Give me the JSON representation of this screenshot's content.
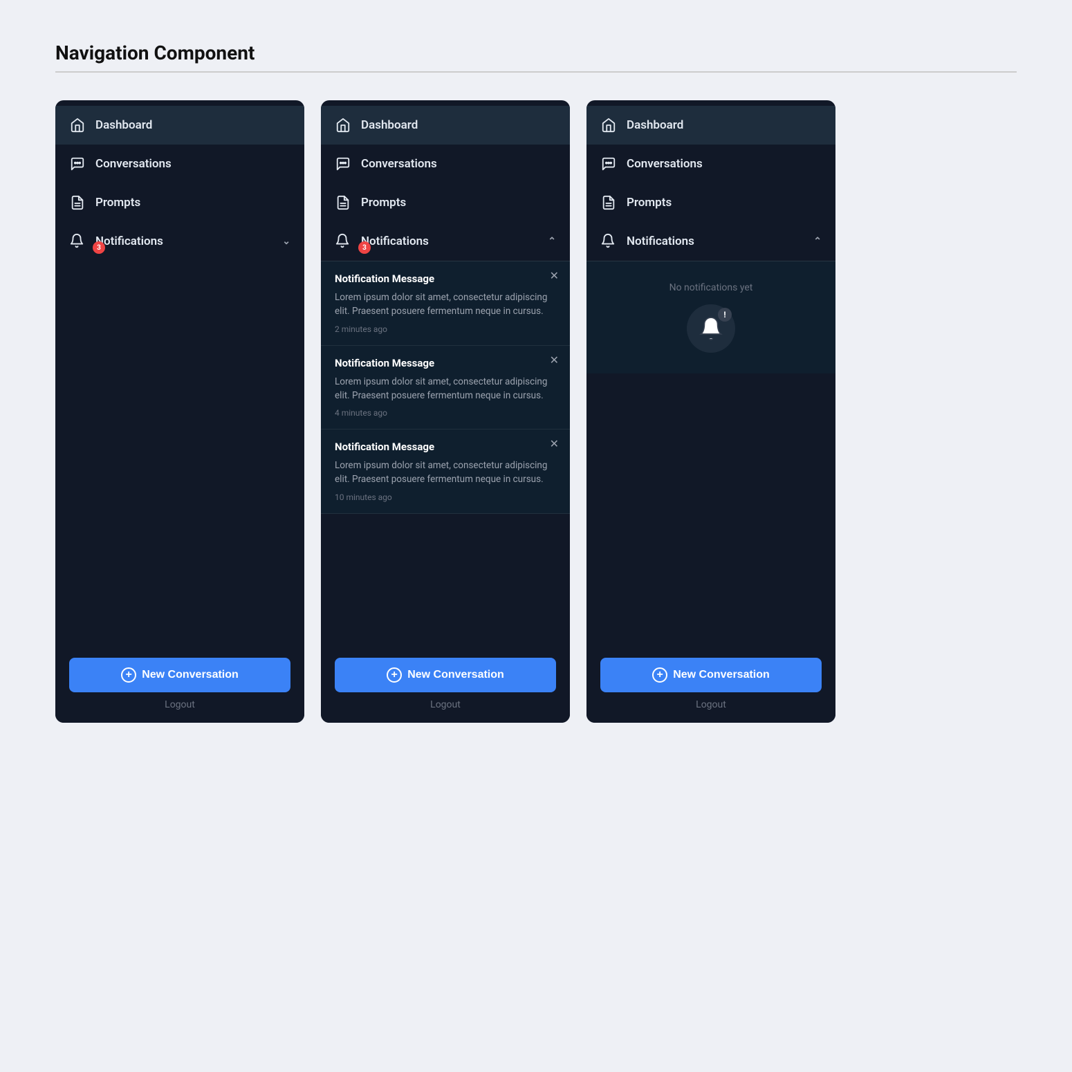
{
  "page": {
    "title": "Navigation Component"
  },
  "nav": {
    "items": [
      {
        "id": "dashboard",
        "label": "Dashboard"
      },
      {
        "id": "conversations",
        "label": "Conversations"
      },
      {
        "id": "prompts",
        "label": "Prompts"
      },
      {
        "id": "notifications",
        "label": "Notifications"
      }
    ],
    "new_conversation_label": "New Conversation",
    "logout_label": "Logout"
  },
  "panels": [
    {
      "id": "panel-collapsed",
      "active_item": "dashboard",
      "notification_badge": "3",
      "notifications_expanded": false,
      "notifications": []
    },
    {
      "id": "panel-expanded",
      "active_item": "dashboard",
      "notification_badge": "3",
      "notifications_expanded": true,
      "notifications": [
        {
          "title": "Notification Message",
          "body": "Lorem ipsum dolor sit amet, consectetur adipiscing elit. Praesent posuere fermentum neque in cursus.",
          "time": "2 minutes ago"
        },
        {
          "title": "Notification Message",
          "body": "Lorem ipsum dolor sit amet, consectetur adipiscing elit. Praesent posuere fermentum neque in cursus.",
          "time": "4 minutes ago"
        },
        {
          "title": "Notification Message",
          "body": "Lorem ipsum dolor sit amet, consectetur adipiscing elit. Praesent posuere fermentum neque in cursus.",
          "time": "10 minutes ago"
        }
      ]
    },
    {
      "id": "panel-empty",
      "active_item": "dashboard",
      "notification_badge": "",
      "notifications_expanded": true,
      "notifications": [],
      "empty_label": "No notifications yet"
    }
  ]
}
